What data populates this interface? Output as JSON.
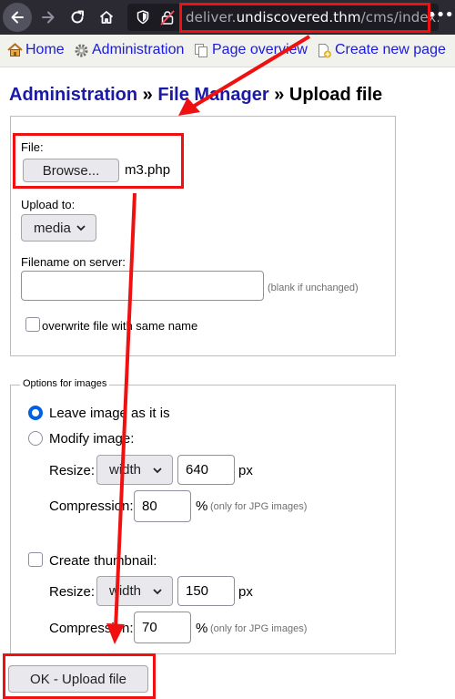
{
  "browser": {
    "url_host_prefix": "deliver.",
    "url_host_main": "undiscovered.thm",
    "url_path": "/cms/index.p",
    "icons": [
      "back-arrow-icon",
      "forward-arrow-icon",
      "reload-icon",
      "home-icon",
      "shield-icon",
      "insecure-lock-icon",
      "menu-dots-icon"
    ]
  },
  "menu": {
    "home": "Home",
    "administration": "Administration",
    "page_overview": "Page overview",
    "create_new_page": "Create new page"
  },
  "heading": {
    "admin": "Administration",
    "sep1": " » ",
    "file_manager": "File Manager",
    "sep2": " » ",
    "current": "Upload file"
  },
  "upload": {
    "file_label": "File:",
    "browse_label": "Browse...",
    "file_name": "m3.php",
    "upload_to_label": "Upload to:",
    "upload_to_value": "media",
    "filename_label": "Filename on server:",
    "filename_value": "",
    "filename_hint": "(blank if unchanged)",
    "overwrite_label": "overwrite file with same name",
    "overwrite_checked": false
  },
  "image_options": {
    "legend": "Options for images",
    "leave_label": "Leave image as it is",
    "modify_label": "Modify image:",
    "selected": "leave",
    "resize_label": "Resize:",
    "resize_mode": "width",
    "resize_value": "640",
    "unit": "px",
    "compression_label": "Compression:",
    "compression_value": "80",
    "percent": "%",
    "jpg_hint": "(only for JPG images)",
    "thumbnail_label": "Create thumbnail:",
    "thumbnail_checked": false,
    "thumb_resize_label": "Resize:",
    "thumb_resize_mode": "width",
    "thumb_resize_value": "150",
    "thumb_unit": "px",
    "thumb_compression_label": "Compression:",
    "thumb_compression_value": "70",
    "thumb_percent": "%",
    "thumb_jpg_hint": "(only for JPG images)"
  },
  "submit_label": "OK - Upload file",
  "annotation_color": "#ef1111"
}
